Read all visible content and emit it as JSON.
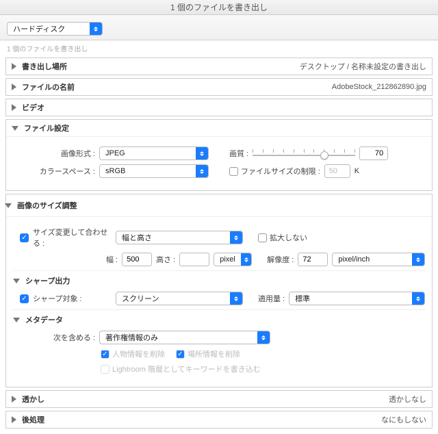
{
  "title": "1 個のファイルを書き出し",
  "toolbar": {
    "preset": "ハードディスク"
  },
  "subcaption": "1 個のファイルを書き出し",
  "sections": {
    "location": {
      "title": "書き出し場所",
      "value": "デスクトップ / 名称未設定の書き出し"
    },
    "filename": {
      "title": "ファイルの名前",
      "value": "AdobeStock_212862890.jpg"
    },
    "video": {
      "title": "ビデオ"
    },
    "filesettings": {
      "title": "ファイル設定",
      "format_label": "画像形式 :",
      "format_value": "JPEG",
      "colorspace_label": "カラースペース :",
      "colorspace_value": "sRGB",
      "quality_label": "画質 :",
      "quality_value": "70",
      "limit_label": "ファイルサイズの制限 :",
      "limit_value": "50",
      "limit_unit": "K"
    },
    "sizing": {
      "title": "画像のサイズ調整",
      "resize_label": "サイズ変更して合わせる :",
      "resize_value": "幅と高さ",
      "noenlarge_label": "拡大しない",
      "w_label": "幅 :",
      "w_value": "500",
      "h_label": "高さ :",
      "h_value": "",
      "unit_value": "pixel",
      "res_label": "解像度 :",
      "res_value": "72",
      "res_unit": "pixel/inch"
    },
    "sharpen": {
      "title": "シャープ出力",
      "target_label": "シャープ対象 :",
      "target_value": "スクリーン",
      "amount_label": "適用量 :",
      "amount_value": "標準"
    },
    "metadata": {
      "title": "メタデータ",
      "include_label": "次を含める :",
      "include_value": "著作権情報のみ",
      "remove_person": "人物情報を削除",
      "remove_location": "場所情報を削除",
      "lightroom": "Lightroom 階層としてキーワードを書き込む"
    },
    "watermark": {
      "title": "透かし",
      "value": "透かしなし"
    },
    "post": {
      "title": "後処理",
      "value": "なにもしない"
    }
  }
}
